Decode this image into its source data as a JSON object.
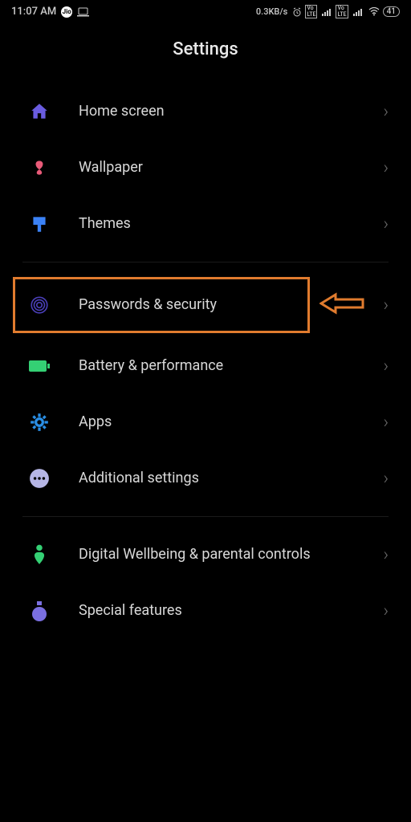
{
  "status": {
    "time": "11:07 AM",
    "data_rate": "0.3KB/s",
    "battery": "41"
  },
  "header": {
    "title": "Settings"
  },
  "rows": {
    "home": "Home screen",
    "wallpaper": "Wallpaper",
    "themes": "Themes",
    "passwords": "Passwords & security",
    "battery": "Battery & performance",
    "apps": "Apps",
    "additional": "Additional settings",
    "wellbeing": "Digital Wellbeing & parental controls",
    "special": "Special features"
  },
  "colors": {
    "purple": "#6a5ce0",
    "pink": "#e85a78",
    "blue": "#3b82f6",
    "green": "#34d074",
    "lavender": "#b6b6e6",
    "highlight": "#e07b2e"
  }
}
